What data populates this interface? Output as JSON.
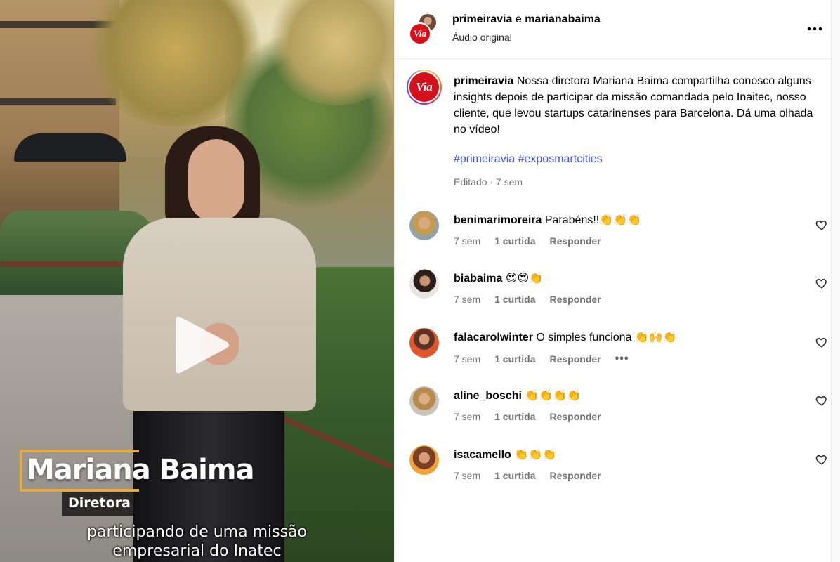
{
  "video": {
    "lower_third_name": "Mariana Baima",
    "lower_third_role": "Diretora",
    "subtitle_line1": "participando de uma missão",
    "subtitle_line2": "empresarial do Inatec",
    "play_icon": "play-icon"
  },
  "header": {
    "user1": "primeiravia",
    "conjunction": "e",
    "user2": "marianabaima",
    "audio": "Áudio original",
    "logo_text": "Via",
    "more_icon": "more-horizontal-icon"
  },
  "caption": {
    "username": "primeiravia",
    "text": "Nossa diretora Mariana Baima compartilha conosco alguns insights depois de participar da missão comandada pelo Inaitec, nosso cliente, que levou startups catarinenses para Barcelona. Dá uma olhada no vídeo!",
    "hashtag1": "#primeiravia",
    "hashtag2": "#exposmartcities",
    "meta": "Editado · 7 sem"
  },
  "comments": [
    {
      "username": "benimarimoreira",
      "text": "Parabéns!!👏👏👏",
      "time": "7 sem",
      "likes": "1 curtida",
      "reply": "Responder"
    },
    {
      "username": "biabaima",
      "text": "😍😍👏",
      "time": "7 sem",
      "likes": "1 curtida",
      "reply": "Responder"
    },
    {
      "username": "falacarolwinter",
      "text": "O simples funciona 👏🙌👏",
      "time": "7 sem",
      "likes": "1 curtida",
      "reply": "Responder",
      "options": "•••"
    },
    {
      "username": "aline_boschi",
      "text": "👏👏👏👏",
      "time": "7 sem",
      "likes": "1 curtida",
      "reply": "Responder"
    },
    {
      "username": "isacamello",
      "text": "👏👏👏",
      "time": "7 sem",
      "likes": "1 curtida",
      "reply": "Responder"
    }
  ],
  "colors": {
    "brand_red": "#d4111b",
    "hashtag_blue": "#4150f7",
    "meta_gray": "#737373",
    "lower_third_gold": "#e6a93a"
  }
}
